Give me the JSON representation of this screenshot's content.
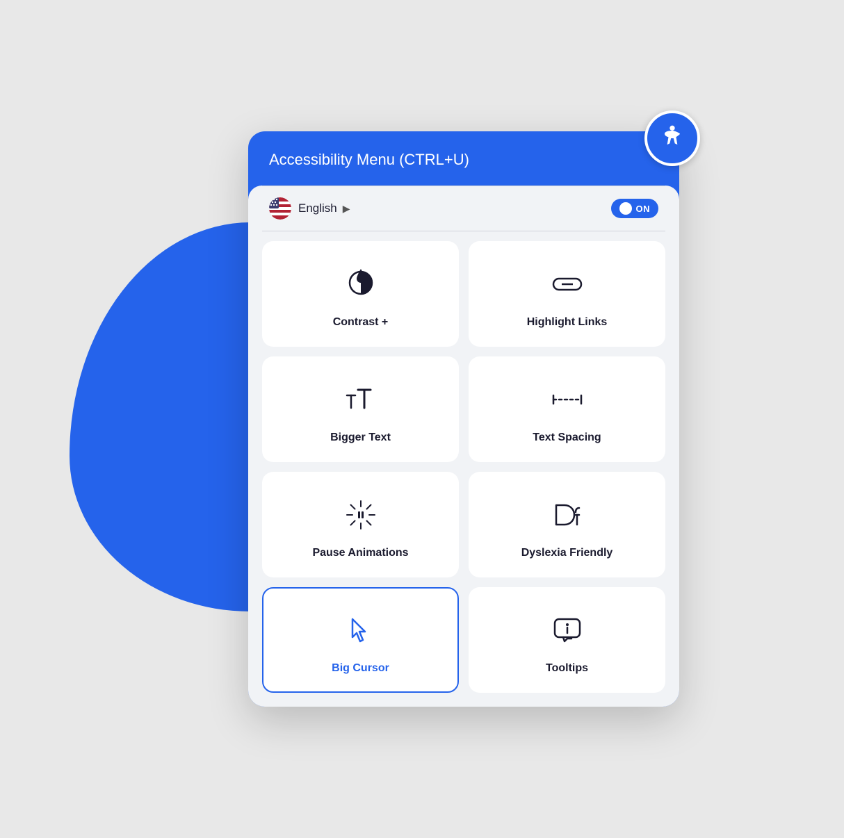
{
  "background": {
    "blob_color": "#2563eb"
  },
  "header": {
    "title_bold": "Accessibility Menu",
    "title_normal": " (CTRL+U)"
  },
  "language": {
    "label": "English",
    "toggle_label": "ON"
  },
  "cards": [
    {
      "id": "contrast",
      "label": "Contrast +",
      "icon": "contrast-icon",
      "active": false
    },
    {
      "id": "highlight-links",
      "label": "Highlight Links",
      "icon": "link-icon",
      "active": false
    },
    {
      "id": "bigger-text",
      "label": "Bigger Text",
      "icon": "text-size-icon",
      "active": false
    },
    {
      "id": "text-spacing",
      "label": "Text Spacing",
      "icon": "spacing-icon",
      "active": false
    },
    {
      "id": "pause-animations",
      "label": "Pause Animations",
      "icon": "pause-icon",
      "active": false
    },
    {
      "id": "dyslexia-friendly",
      "label": "Dyslexia Friendly",
      "icon": "dyslexia-icon",
      "active": false
    },
    {
      "id": "big-cursor",
      "label": "Big Cursor",
      "icon": "cursor-icon",
      "active": true
    },
    {
      "id": "tooltips",
      "label": "Tooltips",
      "icon": "tooltip-icon",
      "active": false
    }
  ]
}
